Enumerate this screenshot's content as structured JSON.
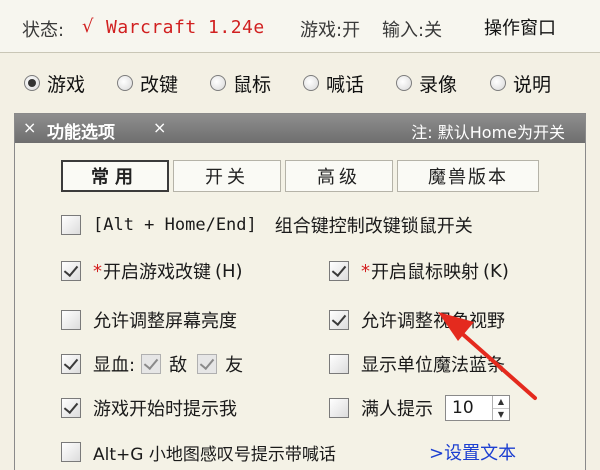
{
  "status": {
    "label": "状态:",
    "check": "√",
    "game": "Warcraft 1.24e",
    "game_state": "游戏:开",
    "input_state": "输入:关",
    "op_window": "操作窗口"
  },
  "modes": [
    {
      "label": "游戏",
      "selected": true
    },
    {
      "label": "改键",
      "selected": false
    },
    {
      "label": "鼠标",
      "selected": false
    },
    {
      "label": "喊话",
      "selected": false
    },
    {
      "label": "录像",
      "selected": false
    },
    {
      "label": "说明",
      "selected": false
    }
  ],
  "panel": {
    "close_left": "×",
    "title": "功能选项",
    "close_title": "×",
    "note": "注: 默认Home为开关"
  },
  "tabs": [
    {
      "label": "常用",
      "active": true
    },
    {
      "label": "开关",
      "active": false
    },
    {
      "label": "高级",
      "active": false
    },
    {
      "label": "魔兽版本",
      "active": false
    }
  ],
  "options": {
    "alt_home_end": {
      "key_text": "[Alt + Home/End]",
      "desc": "组合键控制改键锁鼠开关",
      "checked": false
    },
    "enable_game_keys": {
      "mark": "*",
      "text": "开启游戏改键",
      "hotkey": "(H)",
      "checked": true
    },
    "enable_mouse_map": {
      "mark": "*",
      "text": "开启鼠标映射",
      "hotkey": "(K)",
      "checked": true
    },
    "adjust_brightness": {
      "text": "允许调整屏幕亮度",
      "checked": false
    },
    "adjust_fov": {
      "text": "允许调整视角视野",
      "checked": true
    },
    "show_blood": {
      "text": "显血:",
      "checked": true
    },
    "blood_enemy": {
      "text": "敌",
      "checked": true
    },
    "blood_friend": {
      "text": "友",
      "checked": true
    },
    "show_mana": {
      "text": "显示单位魔法蓝条",
      "checked": false
    },
    "game_start_notify": {
      "text": "游戏开始时提示我",
      "checked": true
    },
    "full_notify": {
      "text": "满人提示",
      "checked": false,
      "count": "10"
    },
    "alt_g_ping": {
      "text": "Alt+G 小地图感叹号提示带喊话",
      "checked": false
    },
    "set_text_link": ">设置文本"
  },
  "colors": {
    "accent_red": "#d12020",
    "link_blue": "#1c3fd1",
    "header_gray": "#7a7a7a",
    "arrow_red": "#e42a1e"
  }
}
